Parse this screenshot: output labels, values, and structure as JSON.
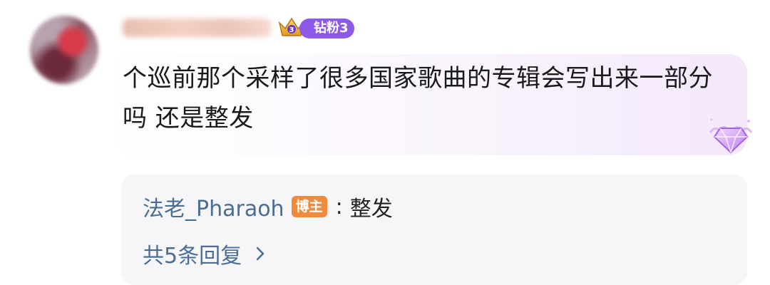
{
  "comment": {
    "fan_badge_label": "钻粉3",
    "text": "个巡前那个采样了很多国家歌曲的专辑会写出来一部分吗 还是整发"
  },
  "reply": {
    "author": "法老_Pharaoh",
    "author_badge": "博主",
    "separator": ":",
    "content": "整发",
    "count_label": "共5条回复"
  },
  "icons": {
    "fan_badge": "crown-icon",
    "decor": "diamond-icon",
    "more": "chevron-right-icon"
  },
  "colors": {
    "fan_badge": "#8e58e8",
    "host_badge": "#f08a3c",
    "link": "#4a6d95"
  }
}
